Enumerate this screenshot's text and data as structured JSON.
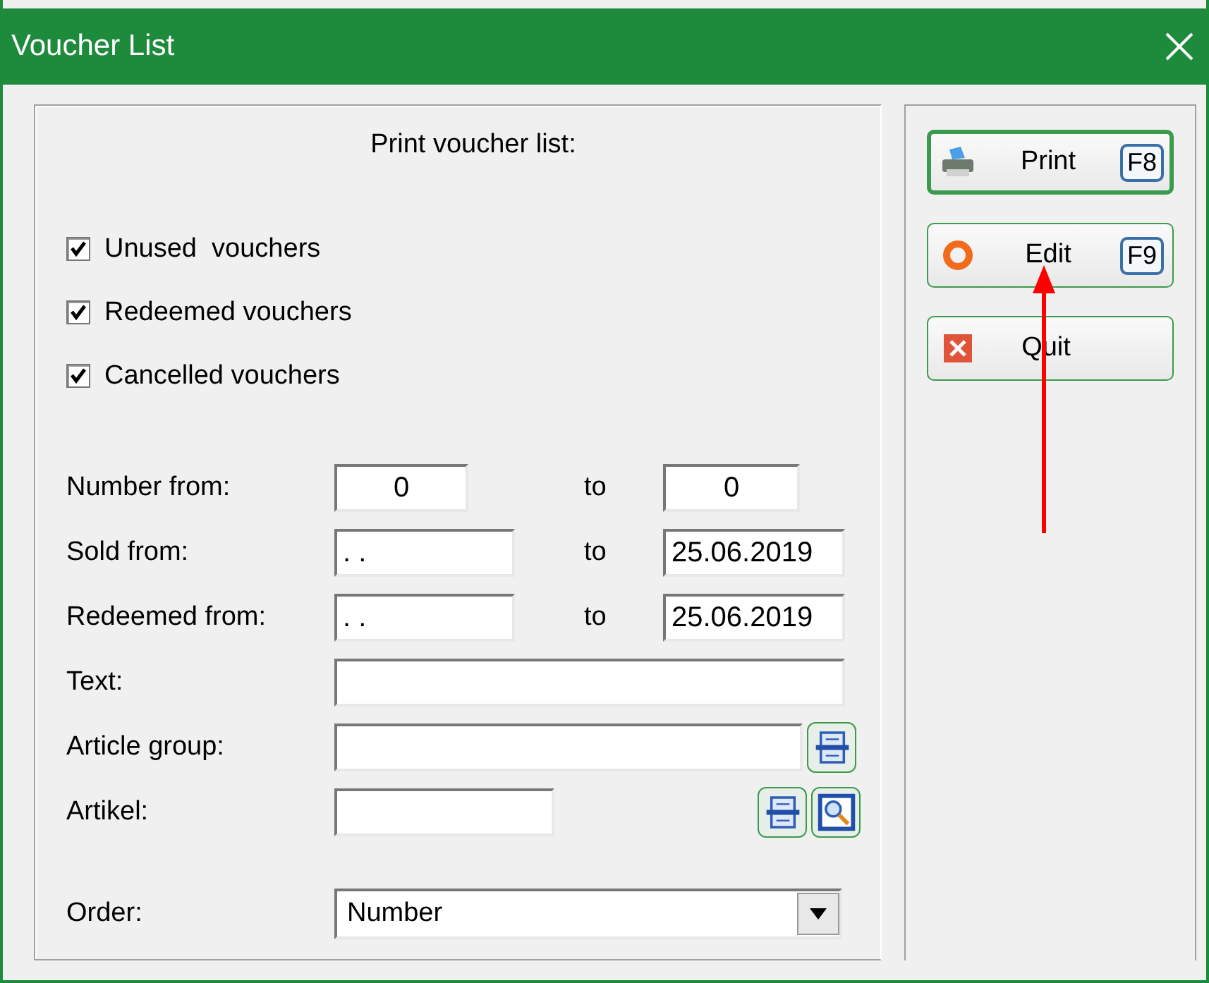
{
  "window": {
    "title": "Voucher List"
  },
  "panel": {
    "heading": "Print voucher list:"
  },
  "checkboxes": [
    {
      "label": "Unused  vouchers",
      "checked": true
    },
    {
      "label": "Redeemed vouchers",
      "checked": true
    },
    {
      "label": "Cancelled vouchers",
      "checked": true
    }
  ],
  "fields": [
    {
      "kind": "number_range",
      "label": "Number from:",
      "from": "0",
      "to_label": "to",
      "to": "0"
    },
    {
      "kind": "date_range",
      "label": "Sold from:",
      "from": ". .",
      "to_label": "to",
      "to": "25.06.2019"
    },
    {
      "kind": "date_range",
      "label": "Redeemed from:",
      "from": ". .",
      "to_label": "to",
      "to": "25.06.2019"
    },
    {
      "kind": "text",
      "label": "Text:"
    },
    {
      "kind": "lookup",
      "label": "Article group:"
    },
    {
      "kind": "lookup_search",
      "label": "Artikel:"
    },
    {
      "kind": "select",
      "label": "Order:",
      "value": "Number"
    }
  ],
  "buttons": [
    {
      "kind": "print",
      "label": "Print",
      "shortcut": "F8",
      "default": true
    },
    {
      "kind": "edit",
      "label": "Edit",
      "shortcut": "F9",
      "default": false
    },
    {
      "kind": "quit",
      "label": "Quit",
      "default": false
    }
  ],
  "annotation": {
    "kind": "arrow"
  }
}
